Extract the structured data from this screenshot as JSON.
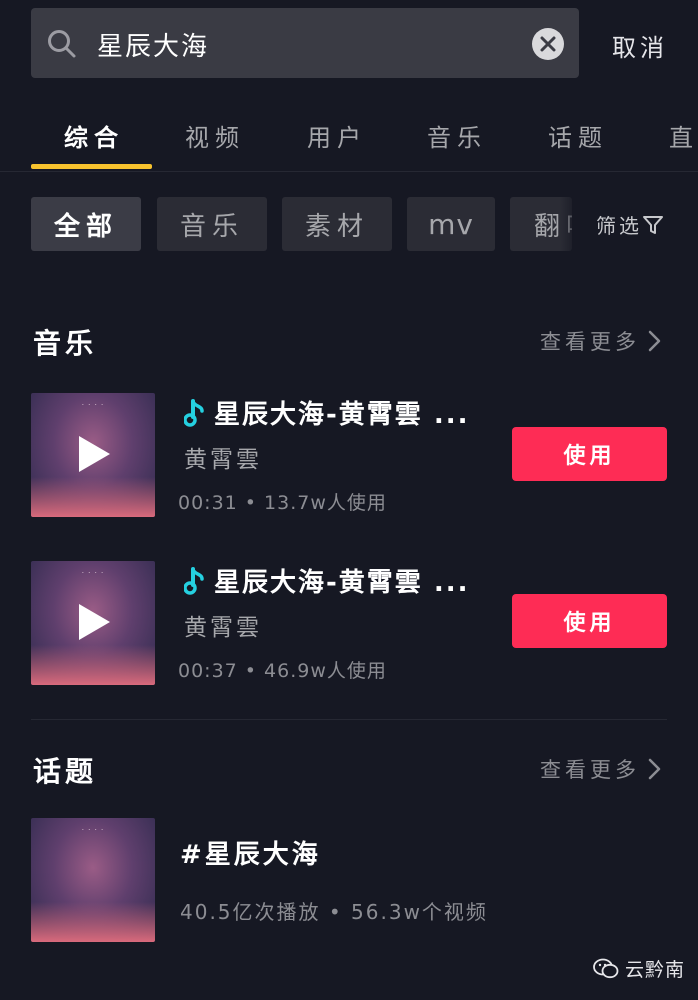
{
  "search": {
    "query": "星辰大海",
    "cancel_label": "取消"
  },
  "tabs": [
    {
      "label": "综合",
      "active": true
    },
    {
      "label": "视频"
    },
    {
      "label": "用户"
    },
    {
      "label": "音乐"
    },
    {
      "label": "话题"
    },
    {
      "label": "直"
    }
  ],
  "filters": {
    "items": [
      {
        "label": "全部",
        "active": true
      },
      {
        "label": "音乐"
      },
      {
        "label": "素材"
      },
      {
        "label": "mv"
      },
      {
        "label": "翻唱"
      }
    ],
    "screen_label": "筛选"
  },
  "music_section": {
    "title": "音乐",
    "more_label": "查看更多",
    "items": [
      {
        "title": "星辰大海-黄霄雲 ...",
        "artist": "黄霄雲",
        "meta": "00:31 • 13.7w人使用",
        "use_label": "使用"
      },
      {
        "title": "星辰大海-黄霄雲 ...",
        "artist": "黄霄雲",
        "meta": "00:37 • 46.9w人使用",
        "use_label": "使用"
      }
    ]
  },
  "topic_section": {
    "title": "话题",
    "more_label": "查看更多",
    "items": [
      {
        "title": "#星辰大海",
        "meta": "40.5亿次播放 • 56.3w个视频"
      }
    ]
  },
  "watermark": "云黔南",
  "colors": {
    "background": "#161823",
    "accent_yellow": "#f8c32e",
    "use_button": "#fe2c55",
    "note_icon": "#25d0e0"
  }
}
